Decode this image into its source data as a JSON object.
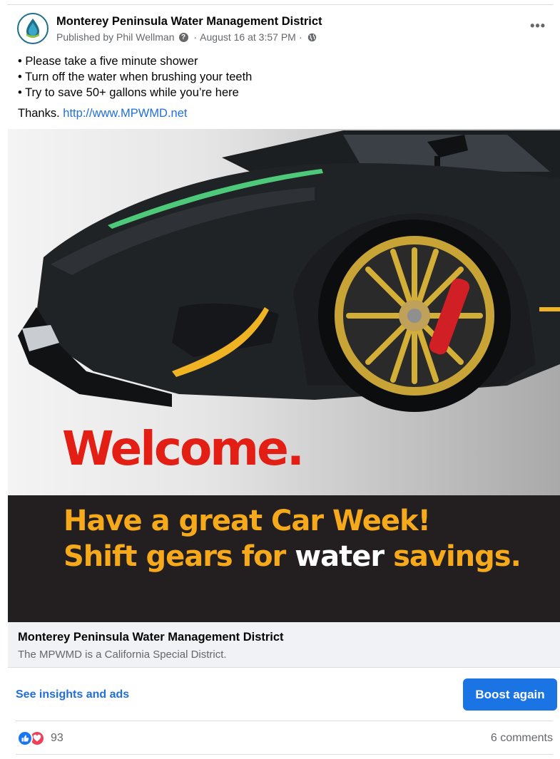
{
  "post": {
    "page_name": "Monterey Peninsula Water Management District",
    "published_by": "Published by Phil Wellman",
    "date": "August 16 at 3:57 PM",
    "separator": "·",
    "more_label": "•••",
    "bullets": [
      "• Please take a five minute shower",
      "• Turn off the water when brushing your teeth",
      "• Try to save 50+ gallons while you’re here"
    ],
    "thanks": "Thanks.",
    "link_text": "http://www.MPWMD.net"
  },
  "image": {
    "welcome": "Welcome.",
    "tagline_1": "Have a great Car Week!",
    "tagline_2a": "Shift gears for",
    "tagline_2b": "water",
    "tagline_2c": "savings."
  },
  "link_preview": {
    "title": "Monterey Peninsula Water Management District",
    "description": "The MPWMD is a California Special District."
  },
  "actions": {
    "insights": "See insights and ads",
    "boost": "Boost again"
  },
  "stats": {
    "reaction_count": "93",
    "comments": "6 comments"
  },
  "icons": {
    "avatar": "water-drop-logo",
    "help": "question-icon",
    "audience": "globe-icon",
    "like": "like-icon",
    "love": "love-icon"
  },
  "colors": {
    "link": "#216fdb",
    "boost_button": "#1b74e4",
    "welcome_red": "#e21e15",
    "tagline_orange": "#f6a91a",
    "banner_dark": "#231f20"
  }
}
